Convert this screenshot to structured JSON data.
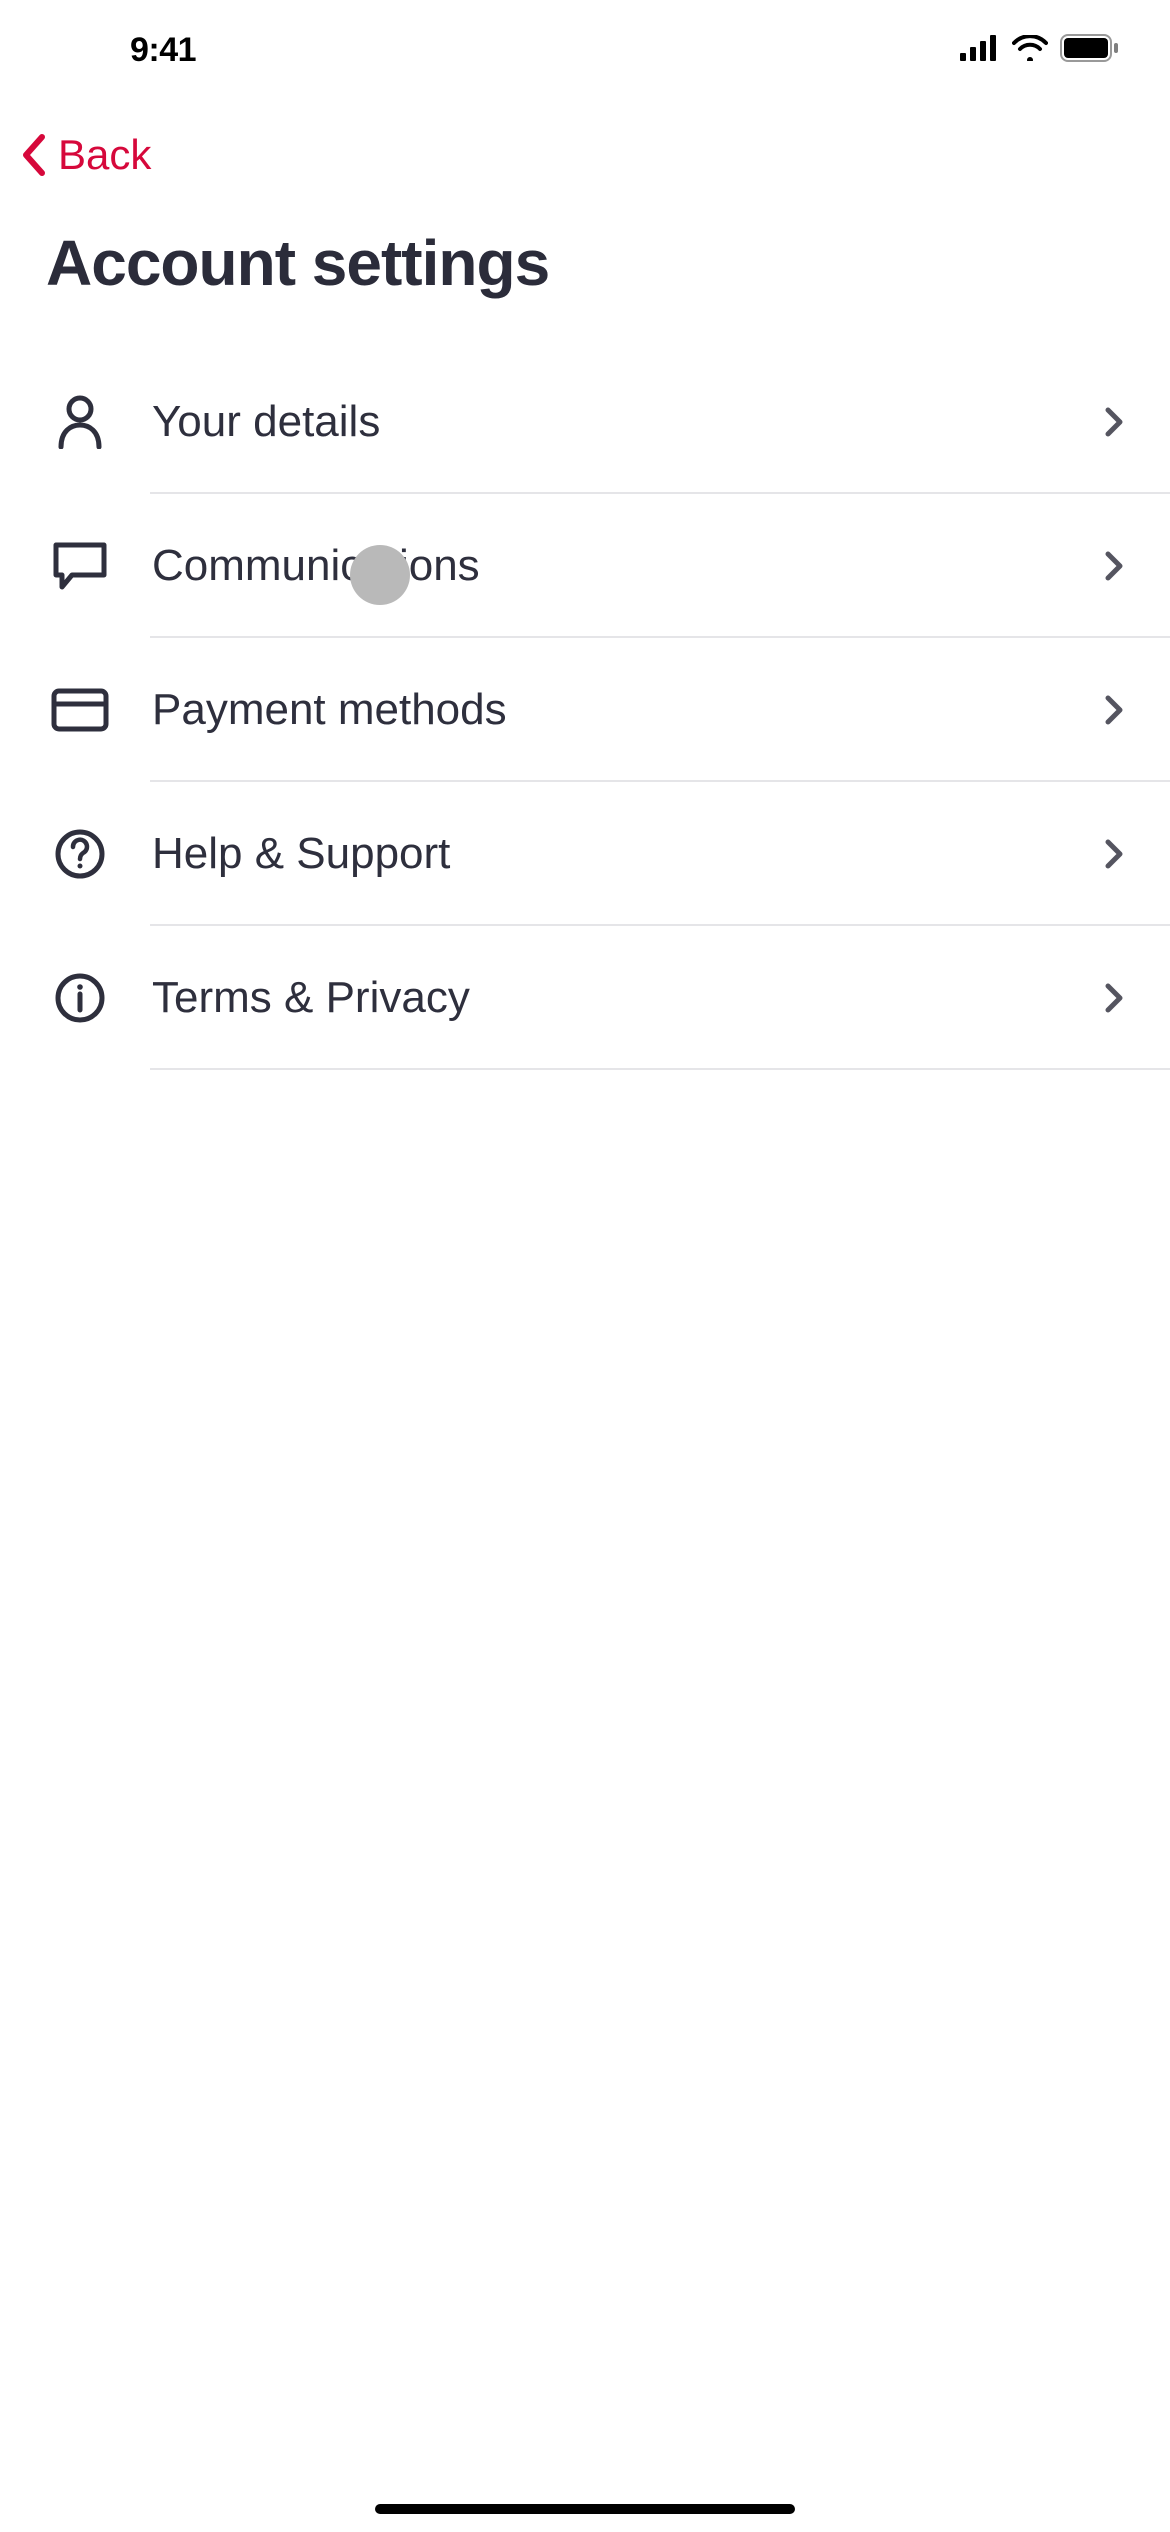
{
  "statusBar": {
    "time": "9:41"
  },
  "nav": {
    "backLabel": "Back"
  },
  "page": {
    "title": "Account settings"
  },
  "colors": {
    "accent": "#d6083b",
    "text": "#2e2f3d",
    "chevron": "#555560"
  },
  "items": [
    {
      "label": "Your details",
      "icon": "user"
    },
    {
      "label": "Communications",
      "icon": "chat"
    },
    {
      "label": "Payment methods",
      "icon": "card"
    },
    {
      "label": "Help & Support",
      "icon": "help"
    },
    {
      "label": "Terms & Privacy",
      "icon": "info"
    }
  ]
}
